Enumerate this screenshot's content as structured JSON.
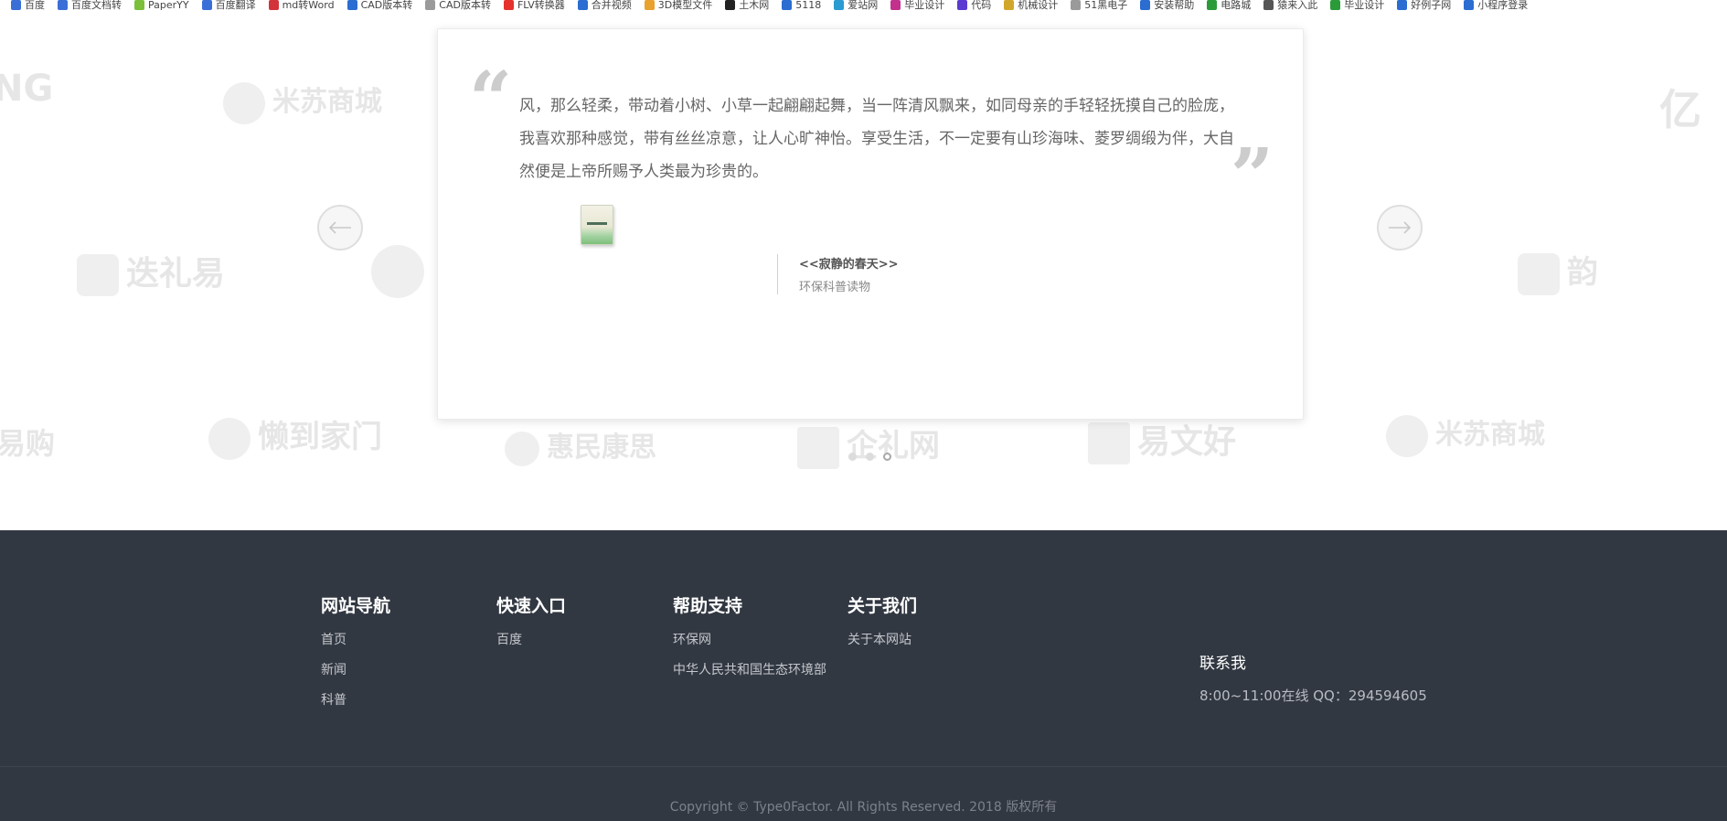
{
  "bookmarks": [
    {
      "label": "百度",
      "color": "#3a6fd8"
    },
    {
      "label": "百度文档转",
      "color": "#3a6fd8"
    },
    {
      "label": "PaperYY",
      "color": "#7bbf3a"
    },
    {
      "label": "百度翻译",
      "color": "#3a6fd8"
    },
    {
      "label": "md转Word",
      "color": "#d3333a"
    },
    {
      "label": "CAD版本转",
      "color": "#2b6dd1"
    },
    {
      "label": "CAD版本转",
      "color": "#9a9a9a"
    },
    {
      "label": "FLV转换器",
      "color": "#e5322d"
    },
    {
      "label": "合并视频",
      "color": "#2b6dd1"
    },
    {
      "label": "3D模型文件",
      "color": "#e8a22d"
    },
    {
      "label": "土木网",
      "color": "#222222"
    },
    {
      "label": "5118",
      "color": "#2b6dd1"
    },
    {
      "label": "爱站网",
      "color": "#2b9bd1"
    },
    {
      "label": "毕业设计",
      "color": "#c2318d"
    },
    {
      "label": "代码",
      "color": "#5b3ad1"
    },
    {
      "label": "机械设计",
      "color": "#d1a72b"
    },
    {
      "label": "51黑电子",
      "color": "#9a9a9a"
    },
    {
      "label": "安装帮助",
      "color": "#2b6dd1"
    },
    {
      "label": "电路城",
      "color": "#2b9b3a"
    },
    {
      "label": "猿来入此",
      "color": "#555555"
    },
    {
      "label": "毕业设计",
      "color": "#2b9b3a"
    },
    {
      "label": "好例子网",
      "color": "#2b6dd1"
    },
    {
      "label": "小程序登录",
      "color": "#2b6dd1"
    }
  ],
  "partners": [
    "NG",
    "米苏商城",
    "亿",
    "迭礼易",
    "懒到家门",
    "惠民康思",
    "企礼网",
    "易文好",
    "米苏商城",
    "易购",
    "韵"
  ],
  "testimonial": {
    "quote": "风，那么轻柔，带动着小树、小草一起翩翩起舞，当一阵清风飘来，如同母亲的手轻轻抚摸自己的脸庞，我喜欢那种感觉，带有丝丝凉意，让人心旷神怡。享受生活，不一定要有山珍海味、菱罗绸缎为伴，大自然便是上帝所赐予人类最为珍贵的。",
    "open_mark": "“",
    "close_mark": "”",
    "book_title": "<<寂静的春天>>",
    "book_sub": "环保科普读物",
    "slides": 3,
    "active_slide": 3
  },
  "footer": {
    "columns": [
      {
        "title": "网站导航",
        "links": [
          "首页",
          "新闻",
          "科普"
        ]
      },
      {
        "title": "快速入口",
        "links": [
          "百度"
        ]
      },
      {
        "title": "帮助支持",
        "links": [
          "环保网",
          "中华人民共和国生态环境部"
        ]
      },
      {
        "title": "关于我们",
        "links": [
          "关于本网站"
        ]
      }
    ],
    "contact_title": "联系我",
    "contact_text": "8:00~11:00在线 QQ：294594605",
    "copyright": "Copyright © Type0Factor. All Rights Reserved. 2018 版权所有"
  }
}
